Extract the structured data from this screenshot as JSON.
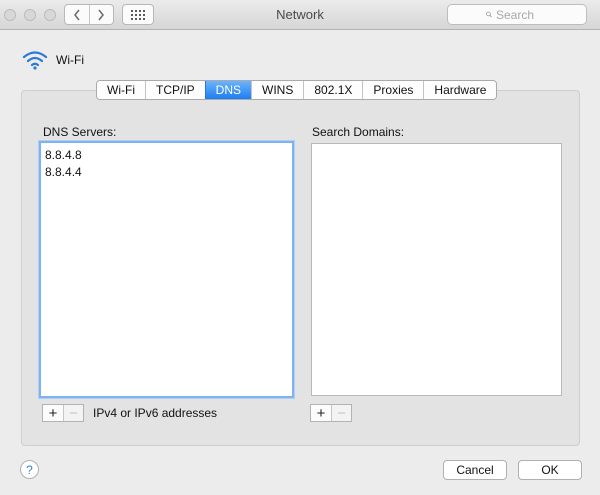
{
  "window": {
    "title": "Network",
    "search_placeholder": "Search"
  },
  "connection": {
    "name": "Wi-Fi",
    "icon": "wifi-icon"
  },
  "tabs": [
    {
      "label": "Wi-Fi",
      "active": false
    },
    {
      "label": "TCP/IP",
      "active": false
    },
    {
      "label": "DNS",
      "active": true
    },
    {
      "label": "WINS",
      "active": false
    },
    {
      "label": "802.1X",
      "active": false
    },
    {
      "label": "Proxies",
      "active": false
    },
    {
      "label": "Hardware",
      "active": false
    }
  ],
  "dns_servers": {
    "label": "DNS Servers:",
    "items": [
      "8.8.4.8",
      "8.8.4.4"
    ],
    "hint": "IPv4 or IPv6 addresses",
    "add_label": "+",
    "remove_label": "−"
  },
  "search_domains": {
    "label": "Search Domains:",
    "items": [],
    "add_label": "+",
    "remove_label": "−"
  },
  "footer": {
    "help_label": "?",
    "cancel_label": "Cancel",
    "ok_label": "OK"
  },
  "colors": {
    "accent": "#1f7ef1",
    "focus_ring": "#7eb3ef",
    "wifi_icon": "#2a79d8"
  }
}
